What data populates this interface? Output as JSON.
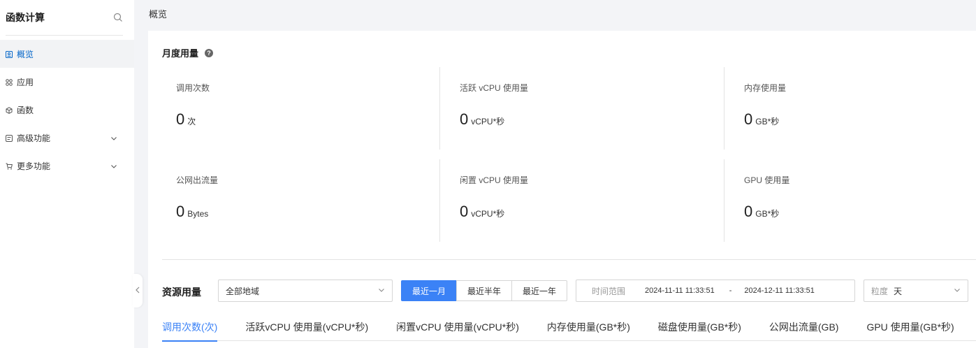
{
  "sidebar": {
    "title": "函数计算",
    "items": [
      {
        "label": "概览",
        "icon": "dashboard-icon",
        "active": true
      },
      {
        "label": "应用",
        "icon": "apps-icon"
      },
      {
        "label": "函数",
        "icon": "cube-icon"
      },
      {
        "label": "高级功能",
        "icon": "advanced-icon",
        "expandable": true
      },
      {
        "label": "更多功能",
        "icon": "cart-icon",
        "expandable": true
      }
    ]
  },
  "page": {
    "title": "概览"
  },
  "monthly": {
    "title": "月度用量",
    "metrics": [
      {
        "label": "调用次数",
        "value": "0",
        "unit": "次"
      },
      {
        "label": "活跃 vCPU 使用量",
        "value": "0",
        "unit": "vCPU*秒"
      },
      {
        "label": "内存使用量",
        "value": "0",
        "unit": "GB*秒"
      },
      {
        "label": "公网出流量",
        "value": "0",
        "unit": "Bytes"
      },
      {
        "label": "闲置 vCPU 使用量",
        "value": "0",
        "unit": "vCPU*秒"
      },
      {
        "label": "GPU 使用量",
        "value": "0",
        "unit": "GB*秒"
      }
    ]
  },
  "resource": {
    "title": "资源用量",
    "region": "全部地域",
    "ranges": [
      "最近一月",
      "最近半年",
      "最近一年"
    ],
    "time_label": "时间范围",
    "start": "2024-11-11 11:33:51",
    "separator": "-",
    "end": "2024-12-11 11:33:51",
    "granularity_label": "粒度",
    "granularity": "天",
    "tabs": [
      "调用次数(次)",
      "活跃vCPU 使用量(vCPU*秒)",
      "闲置vCPU 使用量(vCPU*秒)",
      "内存使用量(GB*秒)",
      "磁盘使用量(GB*秒)",
      "公网出流量(GB)",
      "GPU 使用量(GB*秒)"
    ]
  },
  "colors": {
    "accent": "#3b82f6",
    "active_nav": "#0064c8"
  }
}
